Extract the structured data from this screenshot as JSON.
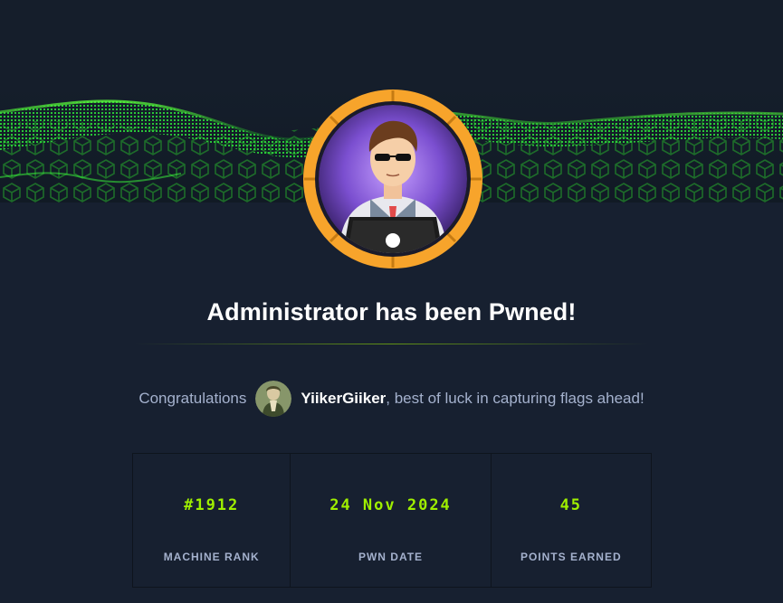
{
  "title": "Administrator has been Pwned!",
  "congrats": {
    "prefix": "Congratulations",
    "username": "YiikerGiiker",
    "suffix": ", best of luck in capturing flags ahead!"
  },
  "stats": [
    {
      "value": "#1912",
      "label": "MACHINE RANK"
    },
    {
      "value": "24 Nov 2024",
      "label": "PWN DATE"
    },
    {
      "value": "45",
      "label": "POINTS EARNED"
    }
  ],
  "colors": {
    "accent": "#9fef00",
    "background": "#172030",
    "ring": "#f7a42b",
    "text_muted": "#a4b1cd"
  },
  "icons": {
    "machine_avatar": "hacker-with-laptop-icon",
    "user_avatar": "user-avatar-icon"
  }
}
